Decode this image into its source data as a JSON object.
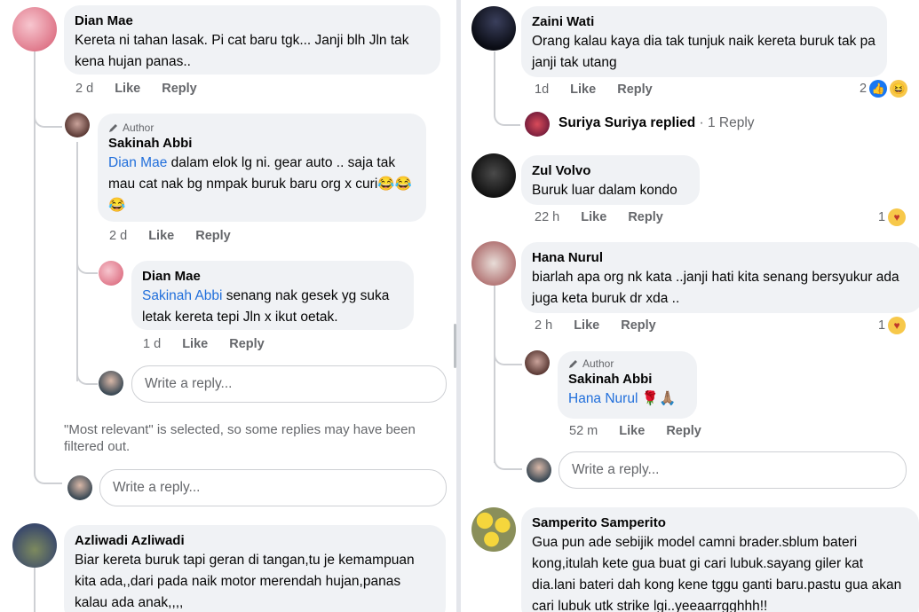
{
  "left": {
    "c1": {
      "name": "Dian Mae",
      "text": "Kereta ni tahan lasak. Pi cat baru tgk... Janji blh Jln tak kena hujan panas..",
      "time": "2 d",
      "like": "Like",
      "reply": "Reply"
    },
    "r1": {
      "author_badge": "Author",
      "name": "Sakinah Abbi",
      "mention": "Dian Mae",
      "text": " dalam elok lg ni. gear auto .. saja tak mau cat nak bg nmpak buruk baru org x curi😂😂😂",
      "time": "2 d",
      "like": "Like",
      "reply": "Reply"
    },
    "r2": {
      "name": "Dian Mae",
      "mention": "Sakinah Abbi",
      "text": " senang nak gesek yg suka letak kereta tepi Jln x ikut oetak.",
      "time": "1 d",
      "like": "Like",
      "reply": "Reply"
    },
    "write_reply_1": "Write a reply...",
    "notice": "\"Most relevant\" is selected, so some replies may have been filtered out.",
    "write_reply_2": "Write a reply...",
    "c2": {
      "name": "Azliwadi Azliwadi",
      "text": "Biar kereta buruk tapi geran di tangan,tu je kemampuan kita ada,,dari pada naik motor merendah hujan,panas kalau ada anak,,,,"
    }
  },
  "right": {
    "c1": {
      "name": "Zaini Wati",
      "text": "Orang kalau kaya dia tak tunjuk naik kereta buruk tak pa janji tak utang",
      "time": "1d",
      "like": "Like",
      "reply": "Reply",
      "react_count": "2"
    },
    "replied": {
      "name": "Suriya Suriya",
      "action": "replied",
      "count": "· 1 Reply"
    },
    "c2": {
      "name": "Zul Volvo",
      "text": "Buruk luar dalam kondo",
      "time": "22 h",
      "like": "Like",
      "reply": "Reply",
      "react_count": "1"
    },
    "c3": {
      "name": "Hana Nurul",
      "text": "biarlah apa org nk kata ..janji hati kita senang bersyukur ada juga keta buruk dr xda ..",
      "time": "2 h",
      "like": "Like",
      "reply": "Reply",
      "react_count": "1"
    },
    "r1": {
      "author_badge": "Author",
      "name": "Sakinah Abbi",
      "mention": "Hana Nurul",
      "text": " 🌹🙏🏽",
      "time": "52 m",
      "like": "Like",
      "reply": "Reply"
    },
    "write_reply": "Write a reply...",
    "c4": {
      "name": "Samperito Samperito",
      "text": "Gua pun ade sebijik model camni brader.sblum bateri kong,itulah kete gua buat gi cari lubuk.sayang giler kat dia.lani bateri dah kong kene tggu ganti baru.pastu gua akan cari lubuk utk strike lgi..yeeaarrgghhh!!"
    }
  },
  "icons": {
    "like": "like-reaction-icon",
    "haha": "haha-reaction-icon",
    "care": "care-reaction-icon",
    "pencil": "pencil-icon"
  },
  "colors": {
    "mention": "#216fdb",
    "bubble": "#f0f2f5",
    "secondary": "#65676b"
  }
}
